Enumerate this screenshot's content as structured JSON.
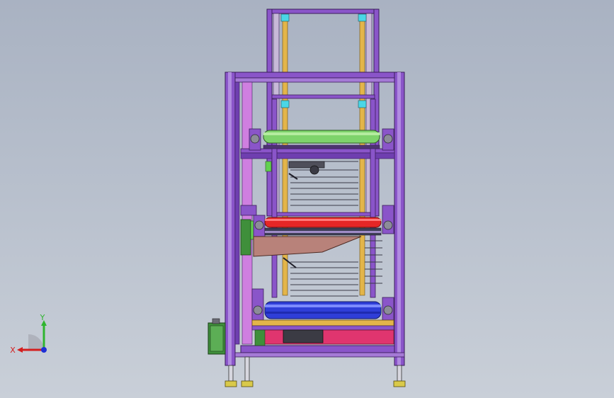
{
  "viewport": {
    "background_top": "#a9b2c2",
    "background_bottom": "#c9cfd8"
  },
  "model": {
    "frame_color": "#8a55c9",
    "frame_edge": "#3a1d5a",
    "rail_color": "#e3b54a",
    "rail_accent": "#4ad6e6",
    "roller_top_color": "#7ed36b",
    "roller_mid_color": "#e52626",
    "roller_low_color": "#2f3ed8",
    "tray_color": "#b8827a",
    "base_panel_color": "#e0356f",
    "motor_color": "#3f8f3b"
  },
  "triad": {
    "x_label": "X",
    "y_label": "Y",
    "x_color": "#d41e1e",
    "y_color": "#2fb52f",
    "z_color": "#1f2fd6"
  }
}
